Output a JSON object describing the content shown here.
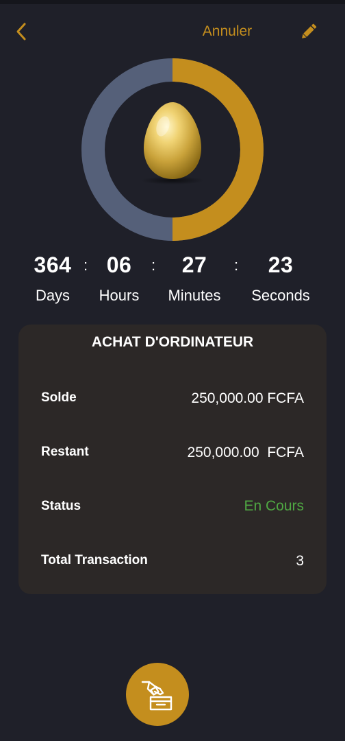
{
  "header": {
    "back_icon": "chevron-left-icon",
    "cancel_label": "Annuler",
    "edit_icon": "pencil-icon",
    "accent_color": "#c48e1e"
  },
  "progress": {
    "elapsed_fraction": 0.5,
    "elapsed_color": "#c48e1e",
    "remaining_color": "#556079",
    "center_image": "golden-egg"
  },
  "countdown": {
    "days": "364",
    "hours": "06",
    "minutes": "27",
    "seconds": "23",
    "separator": ":",
    "days_label": "Days",
    "hours_label": "Hours",
    "minutes_label": "Minutes",
    "seconds_label": "Seconds"
  },
  "goal": {
    "title": "ACHAT D'ORDINATEUR",
    "balance_label": "Solde",
    "balance_value": "250,000.00 FCFA",
    "remaining_label": "Restant",
    "remaining_value": "250,000.00  FCFA",
    "status_label": "Status",
    "status_value": "En Cours",
    "status_color": "#4fa843",
    "transactions_label": "Total Transaction",
    "transactions_value": "3"
  },
  "fab": {
    "icon": "hand-deposit-box-icon"
  }
}
